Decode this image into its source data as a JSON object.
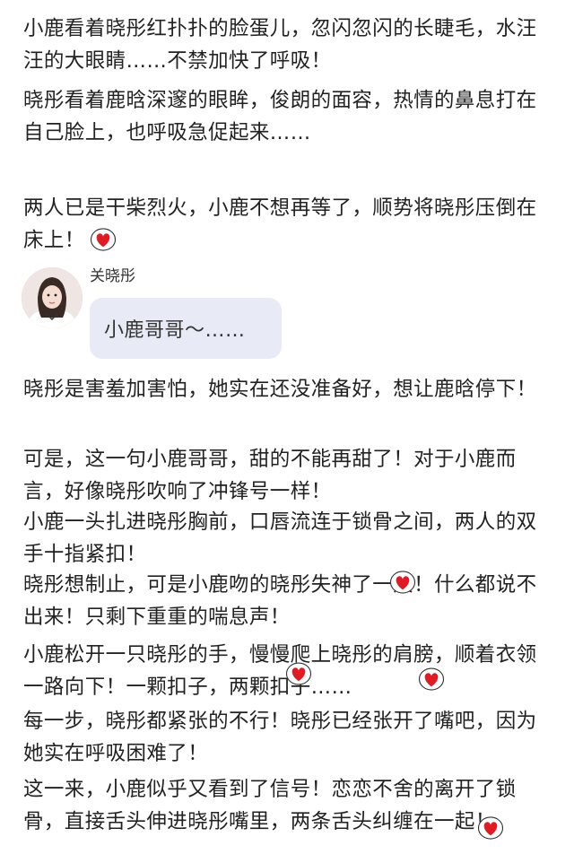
{
  "paragraphs": [
    "小鹿看着晓彤红扑扑的脸蛋儿，忽闪忽闪的长睫毛，水汪汪的大眼睛……不禁加快了呼吸！",
    "晓彤看着鹿晗深邃的眼眸，俊朗的面容，热情的鼻息打在自己脸上，也呼吸急促起来……",
    "两人已是干柴烈火，小鹿不想再等了，顺势将晓彤压倒在床上！",
    "晓彤是害羞加害怕，她实在还没准备好，想让鹿晗停下！",
    "可是，这一句小鹿哥哥，甜的不能再甜了！对于小鹿而言，好像晓彤吹响了冲锋号一样！",
    "小鹿一头扎进晓彤胸前，口唇流连于锁骨之间，两人的双手十指紧扣！",
    "晓彤想制止，可是小鹿吻的晓彤失神了一般！什么都说不出来！只剩下重重的喘息声！",
    "小鹿松开一只晓彤的手，慢慢爬上晓彤的肩膀，顺着衣领一路向下！一颗扣子，两颗扣子……",
    "每一步，晓彤都紧张的不行！晓彤已经张开了嘴吧，因为她实在呼吸困难了！",
    "这一来，小鹿似乎又看到了信号！恋恋不舍的离开了锁骨，直接舌头伸进晓彤嘴里，两条舌头纠缠在一起！"
  ],
  "chat": {
    "sender_name": "关晓彤",
    "message": "小鹿哥哥～……",
    "avatar_icon": "user-avatar-photo"
  },
  "sticker_icon": "heart-sticker-icon",
  "colors": {
    "heart": "#e01b24",
    "bubble": "#e8ebf5",
    "text": "#222222"
  }
}
